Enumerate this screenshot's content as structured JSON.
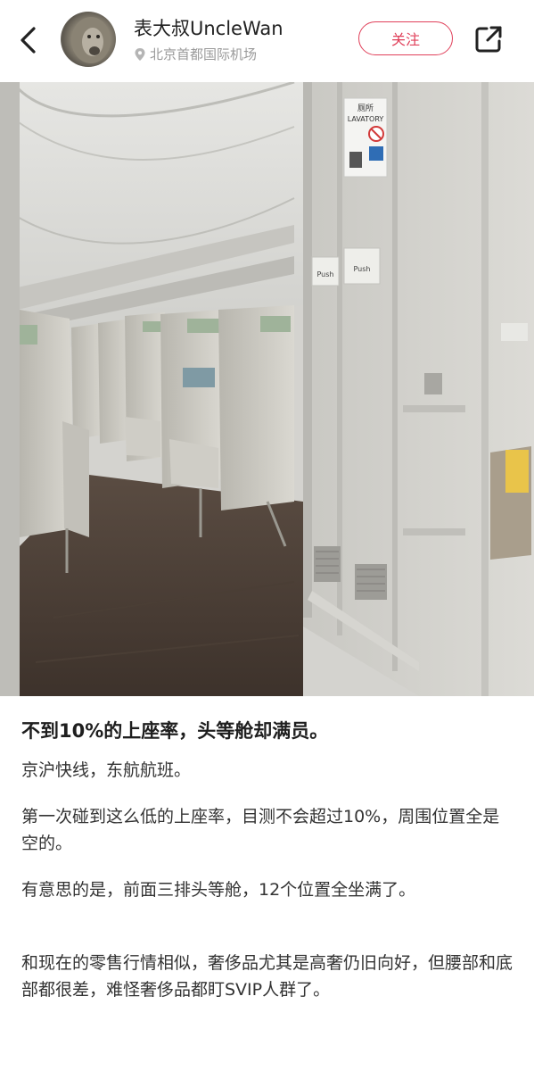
{
  "header": {
    "username": "表大叔UncleWan",
    "location": "北京首都国际机场",
    "follow_label": "关注"
  },
  "photo": {
    "sign_lavatory_cn": "厕所",
    "sign_lavatory_en": "LAVATORY",
    "sign_push": "Push"
  },
  "post": {
    "title": "不到10%的上座率，头等舱却满员。",
    "paragraphs": [
      "京沪快线，东航航班。",
      "第一次碰到这么低的上座率，目测不会超过10%，周围位置全是空的。",
      "有意思的是，前面三排头等舱，12个位置全坐满了。",
      "和现在的零售行情相似，奢侈品尤其是高奢仍旧向好，但腰部和底部都很差，难怪奢侈品都盯SVIP人群了。"
    ]
  },
  "colors": {
    "accent": "#e0405a",
    "muted": "#9a9a9a"
  }
}
